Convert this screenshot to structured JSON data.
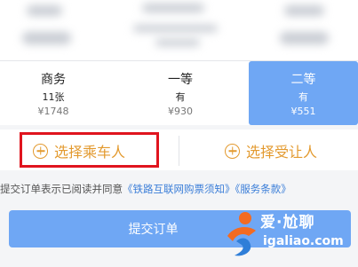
{
  "seats": [
    {
      "name": "商务",
      "count": "11张",
      "price": "¥1748"
    },
    {
      "name": "一等",
      "count": "有",
      "price": "¥930"
    },
    {
      "name": "二等",
      "count": "有",
      "price": "¥551"
    }
  ],
  "passenger": {
    "select_passenger": "选择乘车人",
    "select_beneficiary": "选择受让人"
  },
  "agreement": {
    "text": "提交订单表示已阅读并同意",
    "link1": "《铁路互联网购票须知》",
    "link2": "《服务条款》"
  },
  "submit_label": "提交订单",
  "watermark": {
    "title": "爱·尬聊",
    "url": "igaliao.com"
  },
  "colors": {
    "accent_blue": "#6fa7f4",
    "orange": "#e39a2f",
    "highlight_red": "#e0141e"
  }
}
